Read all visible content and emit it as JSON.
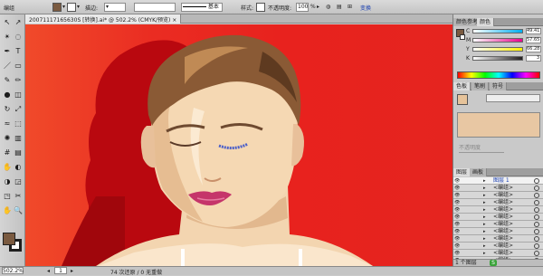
{
  "control_bar": {
    "object_label": "编组",
    "stroke_label": "描边:",
    "brush_label": "基本",
    "style_label": "样式:",
    "opacity_label": "不透明度:",
    "opacity_value": "100",
    "opacity_unit": "%",
    "transform_label": "变换",
    "fill_color": "#7a5a40"
  },
  "document_tab": {
    "title": "20071117165630S [转换].ai* @ 502.2% (CMYK/预览)",
    "close": "×"
  },
  "tools": {
    "icons": [
      "selection-icon",
      "direct-selection-icon",
      "magic-wand-icon",
      "lasso-icon",
      "pen-icon",
      "type-icon",
      "line-icon",
      "rectangle-icon",
      "paintbrush-icon",
      "pencil-icon",
      "blob-brush-icon",
      "eraser-icon",
      "rotate-icon",
      "scale-icon",
      "warp-icon",
      "free-transform-icon",
      "symbol-sprayer-icon",
      "graph-icon",
      "mesh-icon",
      "gradient-icon",
      "eyedropper-icon",
      "blend-icon",
      "live-paint-icon",
      "artboard-icon",
      "slice-icon",
      "scissors-icon",
      "hand-icon",
      "zoom-icon"
    ],
    "glyphs": [
      "↖",
      "↗",
      "✴",
      "◌",
      "✒",
      "T",
      "／",
      "▭",
      "✎",
      "✏",
      "●",
      "◫",
      "↻",
      "⤢",
      "≈",
      "⬚",
      "✺",
      "▥",
      "#",
      "▤",
      "✋",
      "◐",
      "◑",
      "◲",
      "◳",
      "✂",
      "✋",
      "🔍"
    ],
    "fill_color": "#7a5a40",
    "stroke_color": "#ffffff"
  },
  "color_panel": {
    "tabs": [
      "颜色参考",
      "颜色"
    ],
    "active_tab": "颜色",
    "sliders": [
      {
        "key": "C",
        "value": "49.41",
        "color": "#00aeef"
      },
      {
        "key": "M",
        "value": "57.65",
        "color": "#ec008c"
      },
      {
        "key": "Y",
        "value": "66.28",
        "color": "#fff200"
      },
      {
        "key": "K",
        "value": "3",
        "color": "#231f20"
      }
    ]
  },
  "swatch_panel": {
    "tabs": [
      "色板",
      "笔刷",
      "符号"
    ],
    "active_tab": "色板",
    "label": "不透明度",
    "preview_color": "#e6c39a",
    "swatch_color": "#e8c7a3"
  },
  "layers_panel": {
    "tabs": [
      "图层",
      "画板"
    ],
    "active_tab": "图层",
    "layers": [
      {
        "name": "图层 1",
        "selected": true
      },
      {
        "name": "<编组>",
        "selected": false
      },
      {
        "name": "<编组>",
        "selected": false
      },
      {
        "name": "<编组>",
        "selected": false
      },
      {
        "name": "<编组>",
        "selected": false
      },
      {
        "name": "<编组>",
        "selected": false
      },
      {
        "name": "<编组>",
        "selected": false
      },
      {
        "name": "<编组>",
        "selected": false
      },
      {
        "name": "<编组>",
        "selected": false
      },
      {
        "name": "<编组>",
        "selected": false
      },
      {
        "name": "<编组>",
        "selected": false
      },
      {
        "name": "<编组>",
        "selected": false
      }
    ],
    "footer": "1 个图层"
  },
  "status_bar": {
    "zoom": "502.2%",
    "page": "1",
    "message": "74 次还原 / 0 无重做",
    "footer_tag": "S"
  }
}
